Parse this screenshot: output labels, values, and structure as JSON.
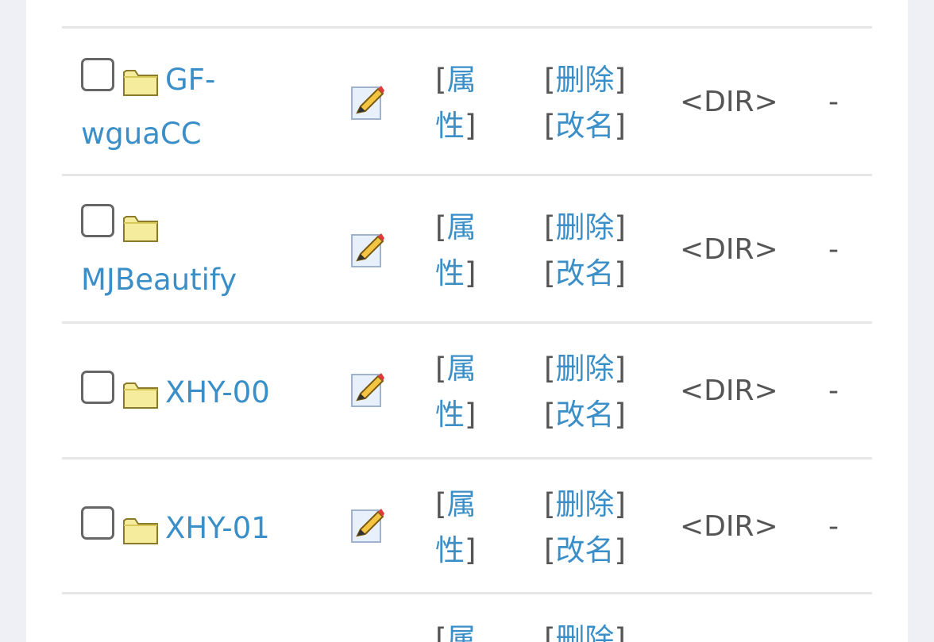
{
  "rows": [
    {
      "name_line1": "GF-",
      "name_line2": "wguaCC",
      "attr_line1": "属",
      "attr_line2": "性",
      "delete_label": "删除",
      "rename_label": "改名",
      "type": "<DIR>",
      "size": "-"
    },
    {
      "name_line1": "",
      "name_line2": "MJBeautify",
      "attr_line1": "属",
      "attr_line2": "性",
      "delete_label": "删除",
      "rename_label": "改名",
      "type": "<DIR>",
      "size": "-"
    },
    {
      "name_line1": "XHY-00",
      "attr_line1": "属",
      "attr_line2": "性",
      "delete_label": "删除",
      "rename_label": "改名",
      "type": "<DIR>",
      "size": "-"
    },
    {
      "name_line1": "XHY-01",
      "attr_line1": "属",
      "attr_line2": "性",
      "delete_label": "删除",
      "rename_label": "改名",
      "type": "<DIR>",
      "size": "-"
    },
    {
      "attr_line1": "属",
      "delete_label": "删除"
    }
  ],
  "brackets": {
    "open": "[",
    "close": "]"
  },
  "icons": {
    "folder": "folder-icon",
    "edit": "pencil-edit-icon"
  },
  "colors": {
    "link": "#3a8fc8",
    "text": "#555555",
    "folder": "#f5ec9e"
  }
}
